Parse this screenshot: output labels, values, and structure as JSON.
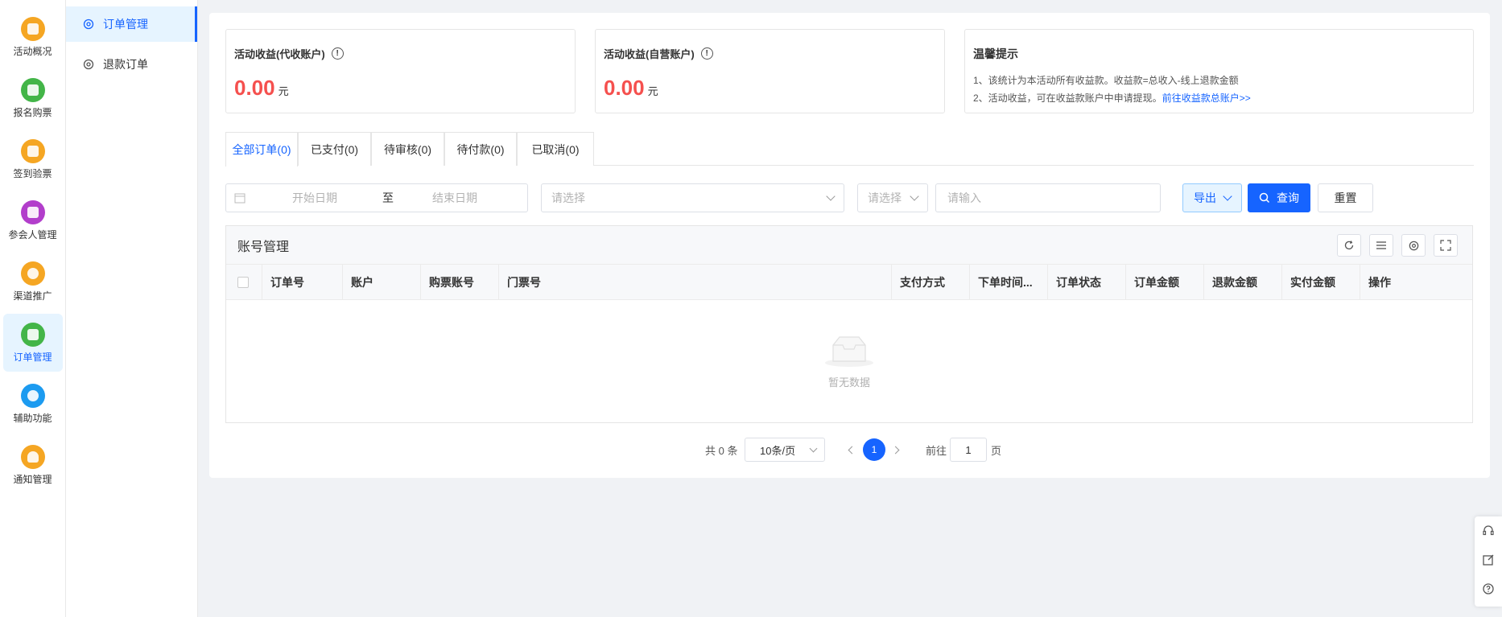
{
  "rail": {
    "items": [
      {
        "label": "活动概况",
        "color": "#f5a623"
      },
      {
        "label": "报名购票",
        "color": "#43b548"
      },
      {
        "label": "签到验票",
        "color": "#f5a623"
      },
      {
        "label": "参会人管理",
        "color": "#b23ecb"
      },
      {
        "label": "渠道推广",
        "color": "#f5a623"
      },
      {
        "label": "订单管理",
        "color": "#43b548"
      },
      {
        "label": "辅助功能",
        "color": "#1c9bf0"
      },
      {
        "label": "通知管理",
        "color": "#f5a623"
      }
    ],
    "active_index": 5
  },
  "subnav": {
    "items": [
      {
        "label": "订单管理"
      },
      {
        "label": "退款订单"
      }
    ]
  },
  "stats": {
    "proxy": {
      "title": "活动收益(代收账户)",
      "info": "!",
      "amount": "0.00",
      "unit": "元"
    },
    "self": {
      "title": "活动收益(自营账户)",
      "info": "!",
      "amount": "0.00",
      "unit": "元"
    },
    "tips": {
      "title": "温馨提示",
      "line1": "1、该统计为本活动所有收益款。收益款=总收入-线上退款金额",
      "line2": "2、活动收益，可在收益款账户中申请提现。",
      "link": "前往收益款总账户>>"
    }
  },
  "tabs": [
    "全部订单(0)",
    "已支付(0)",
    "待审核(0)",
    "待付款(0)",
    "已取消(0)"
  ],
  "filters": {
    "start_date": "开始日期",
    "to": "至",
    "end_date": "结束日期",
    "select1": "请选择",
    "select2": "请选择",
    "input": "请输入",
    "export": "导出",
    "query": "查询",
    "reset": "重置"
  },
  "table": {
    "title": "账号管理",
    "columns": [
      "订单号",
      "账户",
      "购票账号",
      "门票号",
      "支付方式",
      "下单时间...",
      "订单状态",
      "订单金额",
      "退款金额",
      "实付金额",
      "操作"
    ],
    "empty_text": "暂无数据"
  },
  "pager": {
    "total": "共 0 条",
    "page_size": "10条/页",
    "current": "1",
    "goto_label": "前往",
    "goto_value": "1",
    "page_unit": "页"
  },
  "colors": {
    "primary": "#1664ff",
    "amount": "#f5504e"
  }
}
